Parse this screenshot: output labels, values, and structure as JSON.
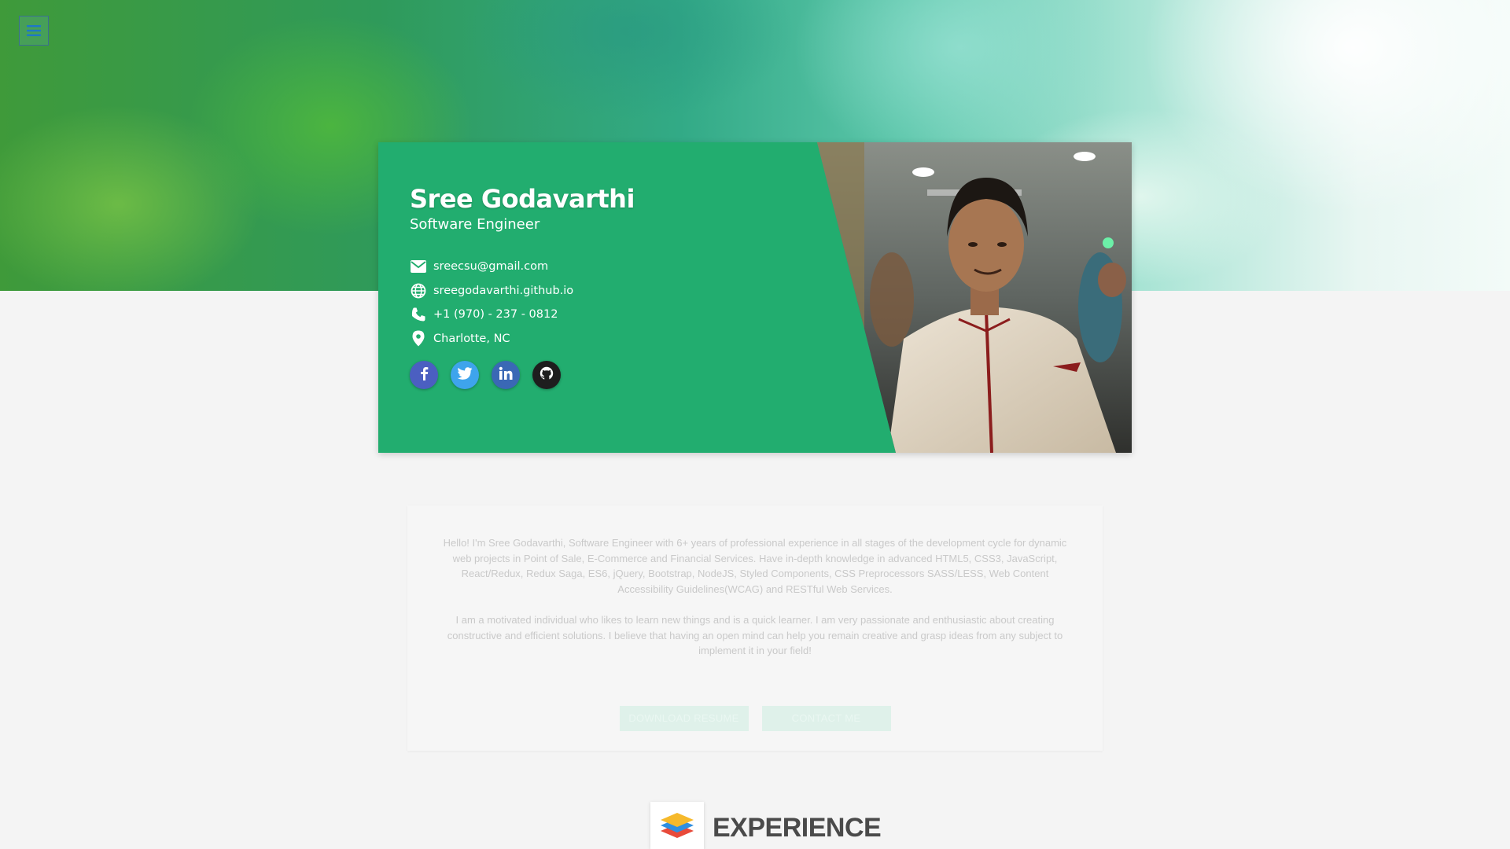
{
  "profile": {
    "name": "Sree Godavarthi",
    "title": "Software Engineer",
    "contacts": [
      {
        "icon": "email-icon",
        "text": "sreecsu@gmail.com"
      },
      {
        "icon": "globe-icon",
        "text": "sreegodavarthi.github.io"
      },
      {
        "icon": "phone-icon",
        "text": "+1 (970) - 237 - 0812"
      },
      {
        "icon": "location-icon",
        "text": "Charlotte, NC"
      }
    ],
    "social": [
      {
        "icon": "facebook-icon",
        "glyph": "f",
        "color": "#4b5fc1"
      },
      {
        "icon": "twitter-icon",
        "glyph": "t",
        "color": "#3ea4ec"
      },
      {
        "icon": "linkedin-icon",
        "glyph": "in",
        "color": "#3a68b5"
      },
      {
        "icon": "github-icon",
        "glyph": "gh",
        "color": "#1e1e1e"
      }
    ]
  },
  "about": {
    "paragraph1": "Hello! I'm Sree Godavarthi, Software Engineer with 6+ years of professional experience in all stages of the development cycle for dynamic web projects in Point of Sale, E-Commerce and Financial Services. Have in-depth knowledge in advanced HTML5, CSS3, JavaScript, React/Redux, Redux Saga, ES6, jQuery, Bootstrap, NodeJS, Styled Components, CSS Preprocessors SASS/LESS, Web Content Accessibility Guidelines(WCAG) and RESTful Web Services.",
    "paragraph2": "I am a motivated individual who likes to learn new things and is a quick learner. I am very passionate and enthusiastic about creating constructive and efficient solutions. I believe that having an open mind can help you remain creative and grasp ideas from any subject to implement it in your field!",
    "download_label": "DOWNLOAD RESUME",
    "contact_label": "CONTACT ME"
  },
  "experience": {
    "heading": "EXPERIENCE"
  },
  "colors": {
    "card_green": "#22ad6f",
    "background": "#f4f4f4"
  }
}
